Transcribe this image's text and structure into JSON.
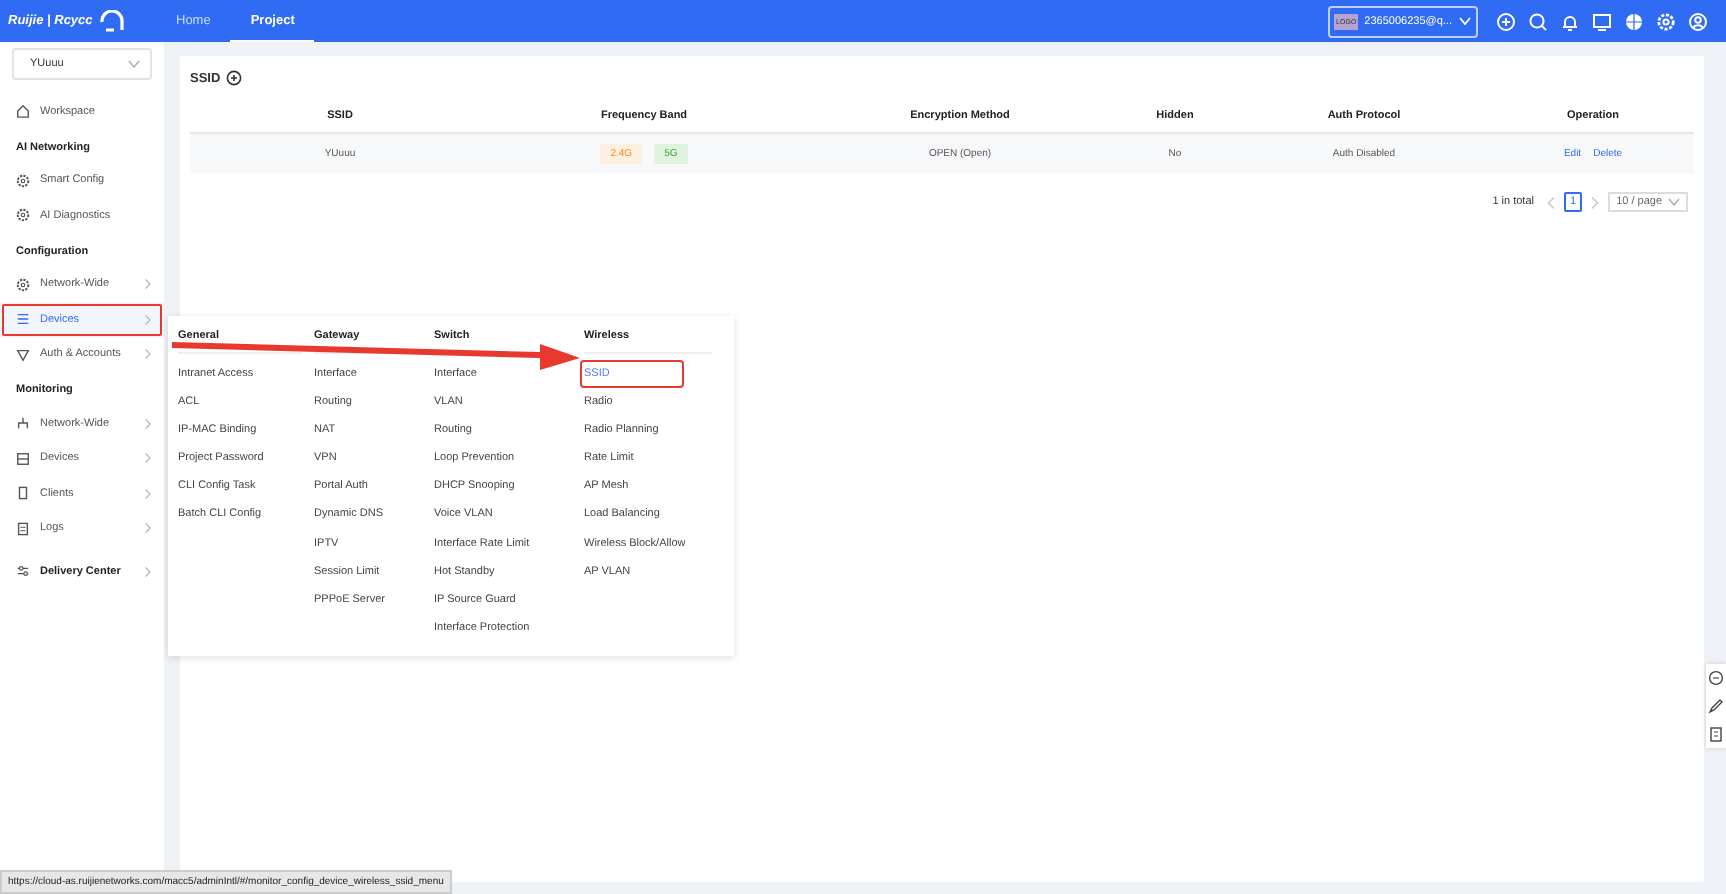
{
  "topbar": {
    "logo": "Ruijie | Rcycc",
    "tabs": [
      {
        "label": "Home",
        "selected": false
      },
      {
        "label": "Project",
        "selected": true
      }
    ],
    "account": {
      "avatar": "LOGO",
      "label": "2365006235@q..."
    }
  },
  "sidebar": {
    "project_select": "YUuuu",
    "sections": [
      {
        "items": [
          {
            "label": "Workspace",
            "chevron": false,
            "selected": false,
            "highlighted": false
          }
        ]
      },
      {
        "heading": "AI Networking",
        "items": [
          {
            "label": "Smart Config",
            "chevron": false,
            "selected": false,
            "highlighted": false
          },
          {
            "label": "AI Diagnostics",
            "chevron": false,
            "selected": false,
            "highlighted": false
          }
        ]
      },
      {
        "heading": "Configuration",
        "items": [
          {
            "label": "Network-Wide",
            "chevron": true,
            "selected": false,
            "highlighted": false
          },
          {
            "label": "Devices",
            "chevron": true,
            "selected": true,
            "highlighted": true
          },
          {
            "label": "Auth & Accounts",
            "chevron": true,
            "selected": false,
            "highlighted": false
          }
        ]
      },
      {
        "heading": "Monitoring",
        "items": [
          {
            "label": "Network-Wide",
            "chevron": true,
            "selected": false,
            "highlighted": false
          },
          {
            "label": "Devices",
            "chevron": true,
            "selected": false,
            "highlighted": false
          },
          {
            "label": "Clients",
            "chevron": true,
            "selected": false,
            "highlighted": false
          },
          {
            "label": "Logs",
            "chevron": true,
            "selected": false,
            "highlighted": false
          }
        ]
      }
    ],
    "footer": {
      "label": "Delivery Center",
      "chevron": true
    }
  },
  "content": {
    "title": "SSID",
    "table": {
      "columns": [
        "SSID",
        "Frequency Band",
        "Encryption Method",
        "Hidden",
        "Auth Protocol",
        "Operation"
      ],
      "rows": [
        {
          "ssid": "YUuuu",
          "bands": [
            {
              "label": "2.4G",
              "kind": "orange"
            },
            {
              "label": "5G",
              "kind": "green"
            }
          ],
          "encryption": "OPEN (Open)",
          "hidden": "No",
          "auth": "Auth Disabled",
          "actions": [
            "Edit",
            "Delete"
          ]
        }
      ]
    },
    "pagination": {
      "total": "1 in total",
      "pages": [
        {
          "label": "1",
          "selected": true
        }
      ],
      "page_size": "10 / page"
    }
  },
  "flyout_menu": {
    "columns": [
      {
        "heading": "General",
        "items": [
          {
            "label": "Intranet Access",
            "selected": false,
            "highlighted": false
          },
          {
            "label": "ACL",
            "selected": false,
            "highlighted": false
          },
          {
            "label": "IP-MAC Binding",
            "selected": false,
            "highlighted": false
          },
          {
            "label": "Project Password",
            "selected": false,
            "highlighted": false
          },
          {
            "label": "CLI Config Task",
            "selected": false,
            "highlighted": false
          },
          {
            "label": "Batch CLI Config",
            "selected": false,
            "highlighted": false
          }
        ]
      },
      {
        "heading": "Gateway",
        "items": [
          {
            "label": "Interface",
            "selected": false,
            "highlighted": false
          },
          {
            "label": "Routing",
            "selected": false,
            "highlighted": false
          },
          {
            "label": "NAT",
            "selected": false,
            "highlighted": false
          },
          {
            "label": "VPN",
            "selected": false,
            "highlighted": false
          },
          {
            "label": "Portal Auth",
            "selected": false,
            "highlighted": false
          },
          {
            "label": "Dynamic DNS",
            "selected": false,
            "highlighted": false
          },
          {
            "label": "IPTV",
            "selected": false,
            "highlighted": false
          },
          {
            "label": "Session Limit",
            "selected": false,
            "highlighted": false
          },
          {
            "label": "PPPoE Server",
            "selected": false,
            "highlighted": false
          }
        ]
      },
      {
        "heading": "Switch",
        "items": [
          {
            "label": "Interface",
            "selected": false,
            "highlighted": false
          },
          {
            "label": "VLAN",
            "selected": false,
            "highlighted": false
          },
          {
            "label": "Routing",
            "selected": false,
            "highlighted": false
          },
          {
            "label": "Loop Prevention",
            "selected": false,
            "highlighted": false
          },
          {
            "label": "DHCP Snooping",
            "selected": false,
            "highlighted": false
          },
          {
            "label": "Voice VLAN",
            "selected": false,
            "highlighted": false
          },
          {
            "label": "Interface Rate Limit",
            "selected": false,
            "highlighted": false
          },
          {
            "label": "Hot Standby",
            "selected": false,
            "highlighted": false
          },
          {
            "label": "IP Source Guard",
            "selected": false,
            "highlighted": false
          },
          {
            "label": "Interface Protection",
            "selected": false,
            "highlighted": false
          }
        ]
      },
      {
        "heading": "Wireless",
        "items": [
          {
            "label": "SSID",
            "selected": true,
            "highlighted": true
          },
          {
            "label": "Radio",
            "selected": false,
            "highlighted": false
          },
          {
            "label": "Radio Planning",
            "selected": false,
            "highlighted": false
          },
          {
            "label": "Rate Limit",
            "selected": false,
            "highlighted": false
          },
          {
            "label": "AP Mesh",
            "selected": false,
            "highlighted": false
          },
          {
            "label": "Load Balancing",
            "selected": false,
            "highlighted": false
          },
          {
            "label": "Wireless Block/Allow",
            "selected": false,
            "highlighted": false
          },
          {
            "label": "AP VLAN",
            "selected": false,
            "highlighted": false
          }
        ]
      }
    ]
  },
  "status_bar": {
    "url": "https://cloud-as.ruijienetworks.com/macc5/adminIntl/#/monitor_config_device_wireless_ssid_menu"
  }
}
